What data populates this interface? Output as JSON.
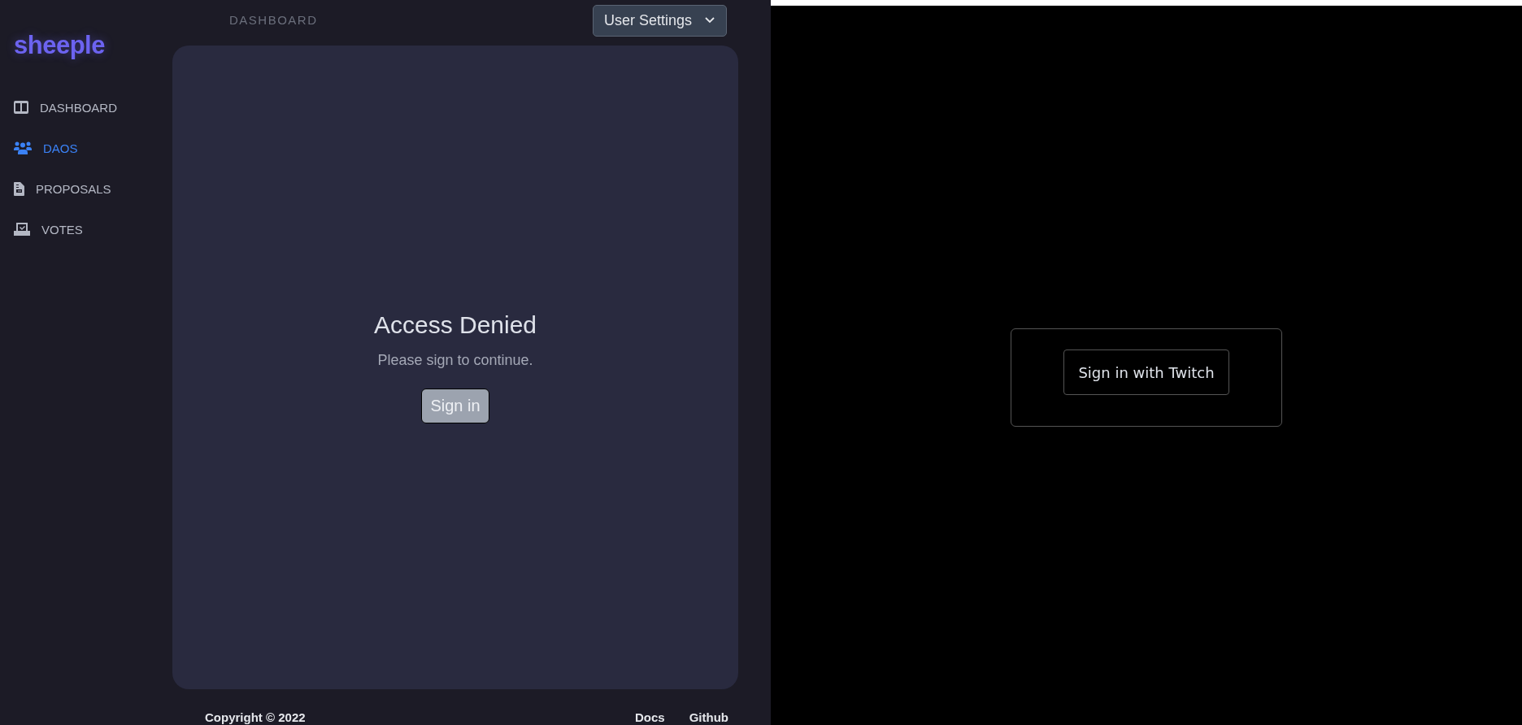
{
  "app": {
    "logo": "sheeple",
    "nav": [
      {
        "label": "DASHBOARD",
        "selected": false
      },
      {
        "label": "DAOS",
        "selected": true
      },
      {
        "label": "PROPOSALS",
        "selected": false
      },
      {
        "label": "VOTES",
        "selected": false
      }
    ],
    "header": {
      "breadcrumb": "DASHBOARD",
      "menu": "User Settings"
    },
    "card": {
      "title": "Access Denied",
      "message": "Please sign to continue.",
      "button": "Sign in"
    },
    "footer": {
      "copyright": "Copyright © 2022",
      "links": [
        "Docs",
        "Github"
      ]
    }
  },
  "popup": {
    "button": "Sign in with Twitch"
  }
}
